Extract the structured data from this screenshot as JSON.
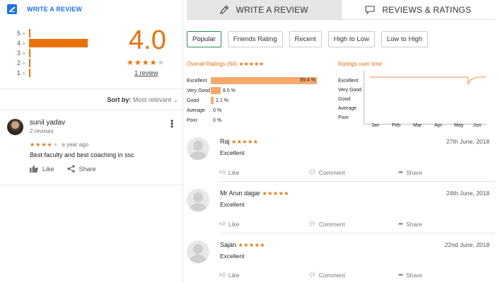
{
  "left": {
    "write_review": "WRITE A REVIEW",
    "histogram": [
      {
        "star": "5",
        "fraction": 0.0
      },
      {
        "star": "4",
        "fraction": 1.0
      },
      {
        "star": "3",
        "fraction": 0.0
      },
      {
        "star": "2",
        "fraction": 0.0
      },
      {
        "star": "1",
        "fraction": 0.0
      }
    ],
    "rating": "4.0",
    "stars_filled": 4,
    "review_count": "1 review",
    "sort_label": "Sort by:",
    "sort_value": "Most relevant",
    "review": {
      "name": "sunil yadav",
      "count": "2 reviews",
      "time": "a year ago",
      "stars": 4,
      "text": "Best faculty and best coaching in ssc",
      "like": "Like",
      "share": "Share"
    }
  },
  "tabs": {
    "write": "WRITE A REVIEW",
    "ratings": "REVIEWS & RATINGS"
  },
  "filters": [
    "Popular",
    "Friends Rating",
    "Recent",
    "High to Low",
    "Low to High"
  ],
  "overall": {
    "title": "Overall Ratings (94) ★★★★★",
    "rows": [
      {
        "label": "Excellent",
        "pct": "89.4 %",
        "value": 89.4
      },
      {
        "label": "Very Good",
        "pct": "8.5 %",
        "value": 8.5
      },
      {
        "label": "Good",
        "pct": "2.1 %",
        "value": 2.1
      },
      {
        "label": "Average",
        "pct": "0 %",
        "value": 0
      },
      {
        "label": "Poor",
        "pct": "0 %",
        "value": 0
      }
    ]
  },
  "over_time": {
    "title": "Ratings over time",
    "labels": [
      "Excellent",
      "Very Good",
      "Good",
      "Average",
      "Poor"
    ],
    "months": [
      "Jan",
      "Feb",
      "Mar",
      "Apr",
      "May",
      "Jun"
    ]
  },
  "reviews": [
    {
      "name": "Raj",
      "date": "27th June, 2018",
      "text": "Excellent"
    },
    {
      "name": "Mr Arun dagar",
      "date": "24th June, 2018",
      "text": "Excellent"
    },
    {
      "name": "Sajan",
      "date": "22nd June, 2018",
      "text": "Excellent"
    }
  ],
  "actions": {
    "like": "Like",
    "comment": "Comment",
    "share": "Share"
  },
  "accent": "#e8710a",
  "link_color": "#1a73e8"
}
